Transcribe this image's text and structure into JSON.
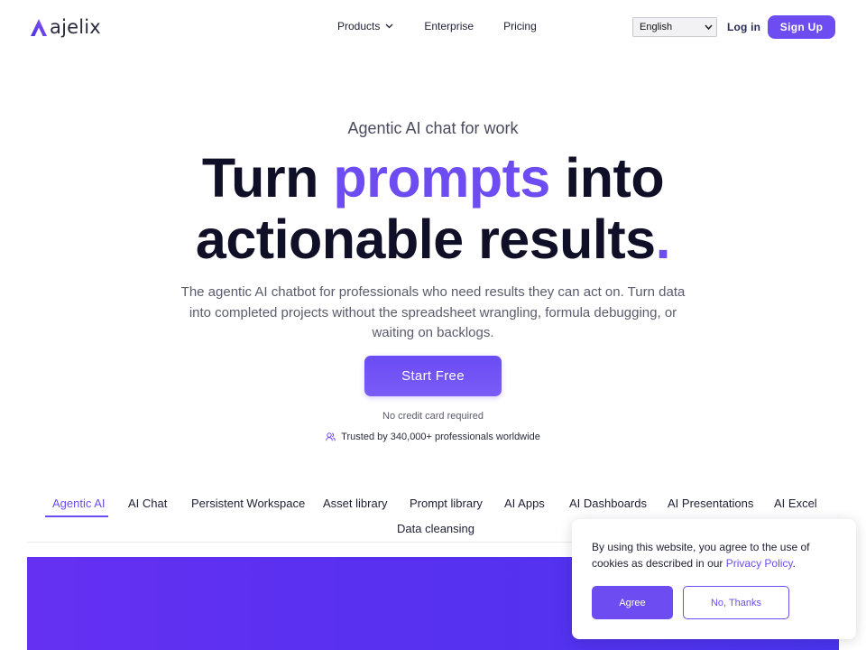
{
  "nav": {
    "logo_text": "ajelix",
    "products_label": "Products",
    "enterprise_label": "Enterprise",
    "pricing_label": "Pricing",
    "language_value": "English",
    "login_label": "Log in",
    "signup_label": "Sign Up"
  },
  "hero": {
    "eyebrow": "Agentic AI chat for work",
    "headline_part1": "Turn ",
    "headline_accent": "prompts",
    "headline_part2": " into",
    "headline_line2": "actionable results",
    "headline_period": ".",
    "subtext": "The agentic AI chatbot for professionals who need results they can act on. Turn data into completed projects without the spreadsheet wrangling, formula debugging, or waiting on backlogs.",
    "cta_label": "Start Free",
    "no_card_note": "No credit card required",
    "trusted_text": "Trusted by 340,000+ professionals worldwide"
  },
  "tabs": [
    {
      "label": "Agentic AI",
      "active": true
    },
    {
      "label": "AI Chat",
      "active": false
    },
    {
      "label": "Persistent Workspace",
      "active": false
    },
    {
      "label": "Asset library",
      "active": false
    },
    {
      "label": "Prompt library",
      "active": false
    },
    {
      "label": "AI Apps",
      "active": false
    },
    {
      "label": "AI Dashboards",
      "active": false
    },
    {
      "label": "AI Presentations",
      "active": false
    },
    {
      "label": "AI Excel",
      "active": false
    },
    {
      "label": "Data cleansing",
      "active": false
    }
  ],
  "cookie": {
    "text_before_link": "By using this website, you agree to the use of cookies as described in our ",
    "link_text": "Privacy Policy",
    "text_after_link": ".",
    "agree_label": "Agree",
    "decline_label": "No, Thanks"
  },
  "colors": {
    "accent": "#6d4df2",
    "heading": "#0f1027",
    "body_text": "#5a5b6c"
  },
  "icons": {
    "logo_mark": "ajelix-a-logo-icon",
    "products_caret": "chevron-down-icon",
    "language_caret": "select-caret-icon",
    "trusted": "users-icon"
  }
}
